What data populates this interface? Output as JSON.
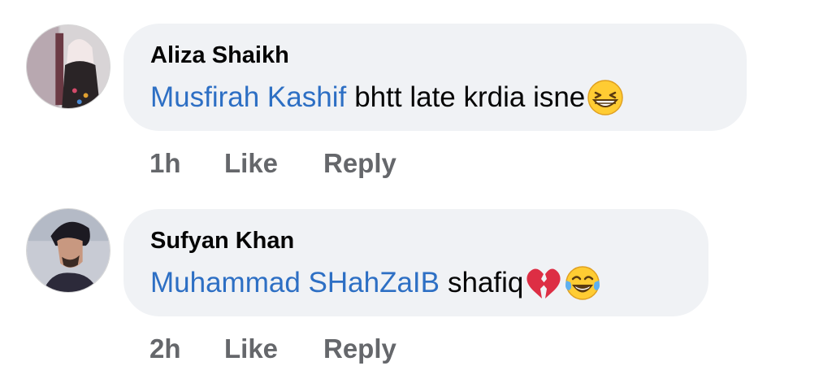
{
  "comments": [
    {
      "author": "Aliza Shaikh",
      "mention": "Musfirah Kashif",
      "text": "bhtt late krdia isne",
      "emojis": [
        "grinning-squinting-emoji"
      ],
      "time": "1h",
      "like_label": "Like",
      "reply_label": "Reply"
    },
    {
      "author": "Sufyan Khan",
      "mention": "Muhammad SHahZaIB",
      "text": "shafiq",
      "emojis": [
        "broken-heart-emoji",
        "tears-of-joy-emoji"
      ],
      "time": "2h",
      "like_label": "Like",
      "reply_label": "Reply"
    }
  ],
  "colors": {
    "bubble_bg": "#f0f2f5",
    "mention": "#2d6fc4",
    "meta": "#65676b",
    "text": "#050505"
  }
}
